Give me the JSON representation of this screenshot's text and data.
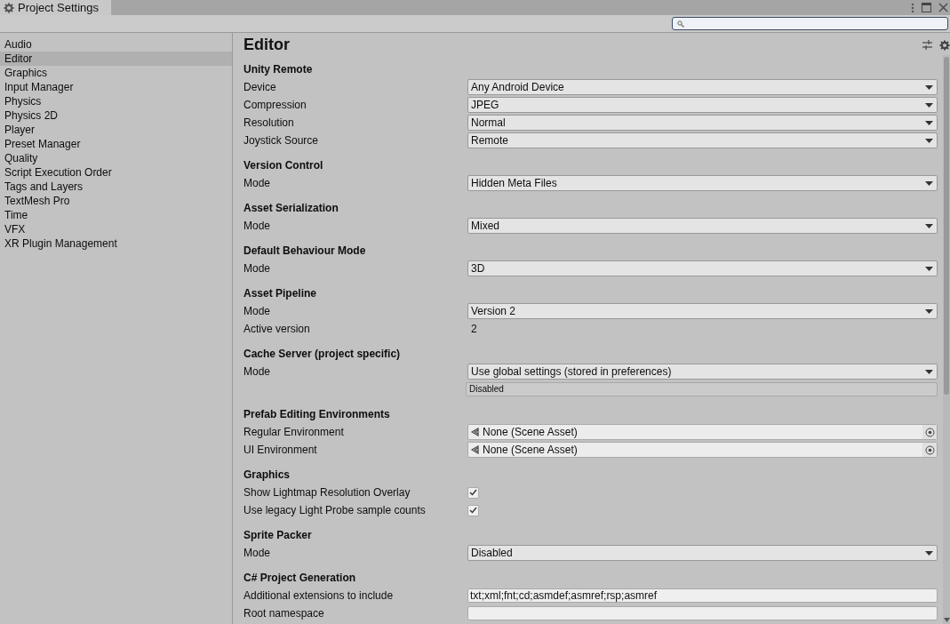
{
  "window": {
    "title": "Project Settings"
  },
  "sidebar": {
    "items": [
      {
        "label": "Audio",
        "selected": false
      },
      {
        "label": "Editor",
        "selected": true
      },
      {
        "label": "Graphics",
        "selected": false
      },
      {
        "label": "Input Manager",
        "selected": false
      },
      {
        "label": "Physics",
        "selected": false
      },
      {
        "label": "Physics 2D",
        "selected": false
      },
      {
        "label": "Player",
        "selected": false
      },
      {
        "label": "Preset Manager",
        "selected": false
      },
      {
        "label": "Quality",
        "selected": false
      },
      {
        "label": "Script Execution Order",
        "selected": false
      },
      {
        "label": "Tags and Layers",
        "selected": false
      },
      {
        "label": "TextMesh Pro",
        "selected": false
      },
      {
        "label": "Time",
        "selected": false
      },
      {
        "label": "VFX",
        "selected": false
      },
      {
        "label": "XR Plugin Management",
        "selected": false
      }
    ]
  },
  "panel": {
    "title": "Editor",
    "sections": [
      {
        "title": "Unity Remote",
        "rows": [
          {
            "kind": "dropdown",
            "label": "Device",
            "value": "Any Android Device"
          },
          {
            "kind": "dropdown",
            "label": "Compression",
            "value": "JPEG"
          },
          {
            "kind": "dropdown",
            "label": "Resolution",
            "value": "Normal"
          },
          {
            "kind": "dropdown",
            "label": "Joystick Source",
            "value": "Remote"
          }
        ]
      },
      {
        "title": "Version Control",
        "rows": [
          {
            "kind": "dropdown",
            "label": "Mode",
            "value": "Hidden Meta Files"
          }
        ]
      },
      {
        "title": "Asset Serialization",
        "rows": [
          {
            "kind": "dropdown",
            "label": "Mode",
            "value": "Mixed"
          }
        ]
      },
      {
        "title": "Default Behaviour Mode",
        "rows": [
          {
            "kind": "dropdown",
            "label": "Mode",
            "value": "3D"
          }
        ]
      },
      {
        "title": "Asset Pipeline",
        "rows": [
          {
            "kind": "dropdown",
            "label": "Mode",
            "value": "Version 2"
          },
          {
            "kind": "text",
            "label": "Active version",
            "value": "2"
          }
        ]
      },
      {
        "title": "Cache Server (project specific)",
        "rows": [
          {
            "kind": "dropdown",
            "label": "Mode",
            "value": "Use global settings (stored in preferences)"
          },
          {
            "kind": "status",
            "value": "Disabled"
          }
        ]
      },
      {
        "title": "Prefab Editing Environments",
        "rows": [
          {
            "kind": "object",
            "label": "Regular Environment",
            "value": "None (Scene Asset)"
          },
          {
            "kind": "object",
            "label": "UI Environment",
            "value": "None (Scene Asset)"
          }
        ]
      },
      {
        "title": "Graphics",
        "rows": [
          {
            "kind": "checkbox",
            "label": "Show Lightmap Resolution Overlay",
            "checked": true
          },
          {
            "kind": "checkbox",
            "label": "Use legacy Light Probe sample counts",
            "checked": true
          }
        ]
      },
      {
        "title": "Sprite Packer",
        "rows": [
          {
            "kind": "dropdown",
            "label": "Mode",
            "value": "Disabled"
          }
        ]
      },
      {
        "title": "C# Project Generation",
        "rows": [
          {
            "kind": "input",
            "label": "Additional extensions to include",
            "value": "txt;xml;fnt;cd;asmdef;asmref;rsp;asmref"
          },
          {
            "kind": "input",
            "label": "Root namespace"
          }
        ]
      }
    ]
  }
}
